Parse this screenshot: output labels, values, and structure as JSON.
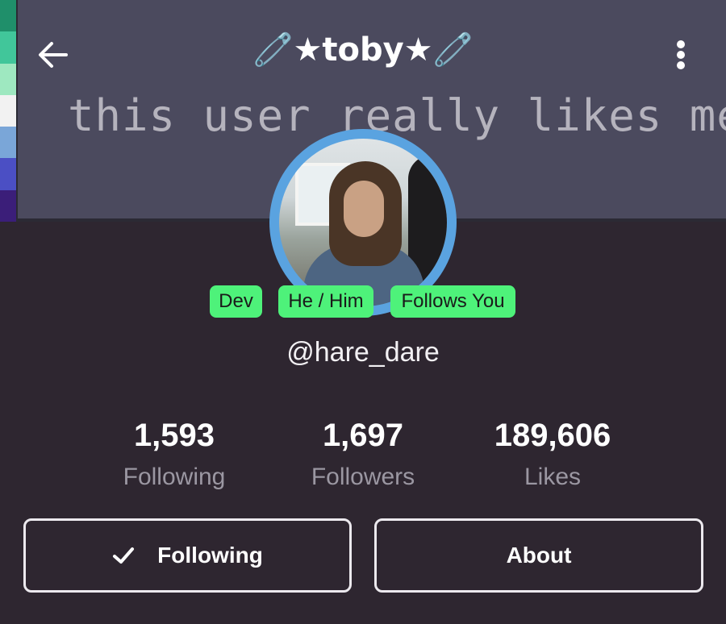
{
  "header": {
    "title": "🧷★toby★🧷",
    "back_icon": "arrow-left-icon",
    "more_icon": "more-vertical-icon"
  },
  "banner": {
    "text": "this user really likes me",
    "flag_colors": [
      "#1f8f6a",
      "#41c69a",
      "#9ee8c0",
      "#f2f2f2",
      "#7aa6d8",
      "#4b4fc4",
      "#3b1e79"
    ]
  },
  "profile": {
    "badges": [
      "Dev",
      "He / Him",
      "Follows You"
    ],
    "handle": "@hare_dare"
  },
  "stats": [
    {
      "value": "1,593",
      "label": "Following"
    },
    {
      "value": "1,697",
      "label": "Followers"
    },
    {
      "value": "189,606",
      "label": "Likes"
    }
  ],
  "actions": {
    "following_label": "Following",
    "about_label": "About",
    "following_icon": "checkmark-icon"
  },
  "colors": {
    "background": "#2e2630",
    "banner": "#4b4a5e",
    "avatar_ring": "#5aa3e0",
    "badge": "#4ef27a"
  }
}
